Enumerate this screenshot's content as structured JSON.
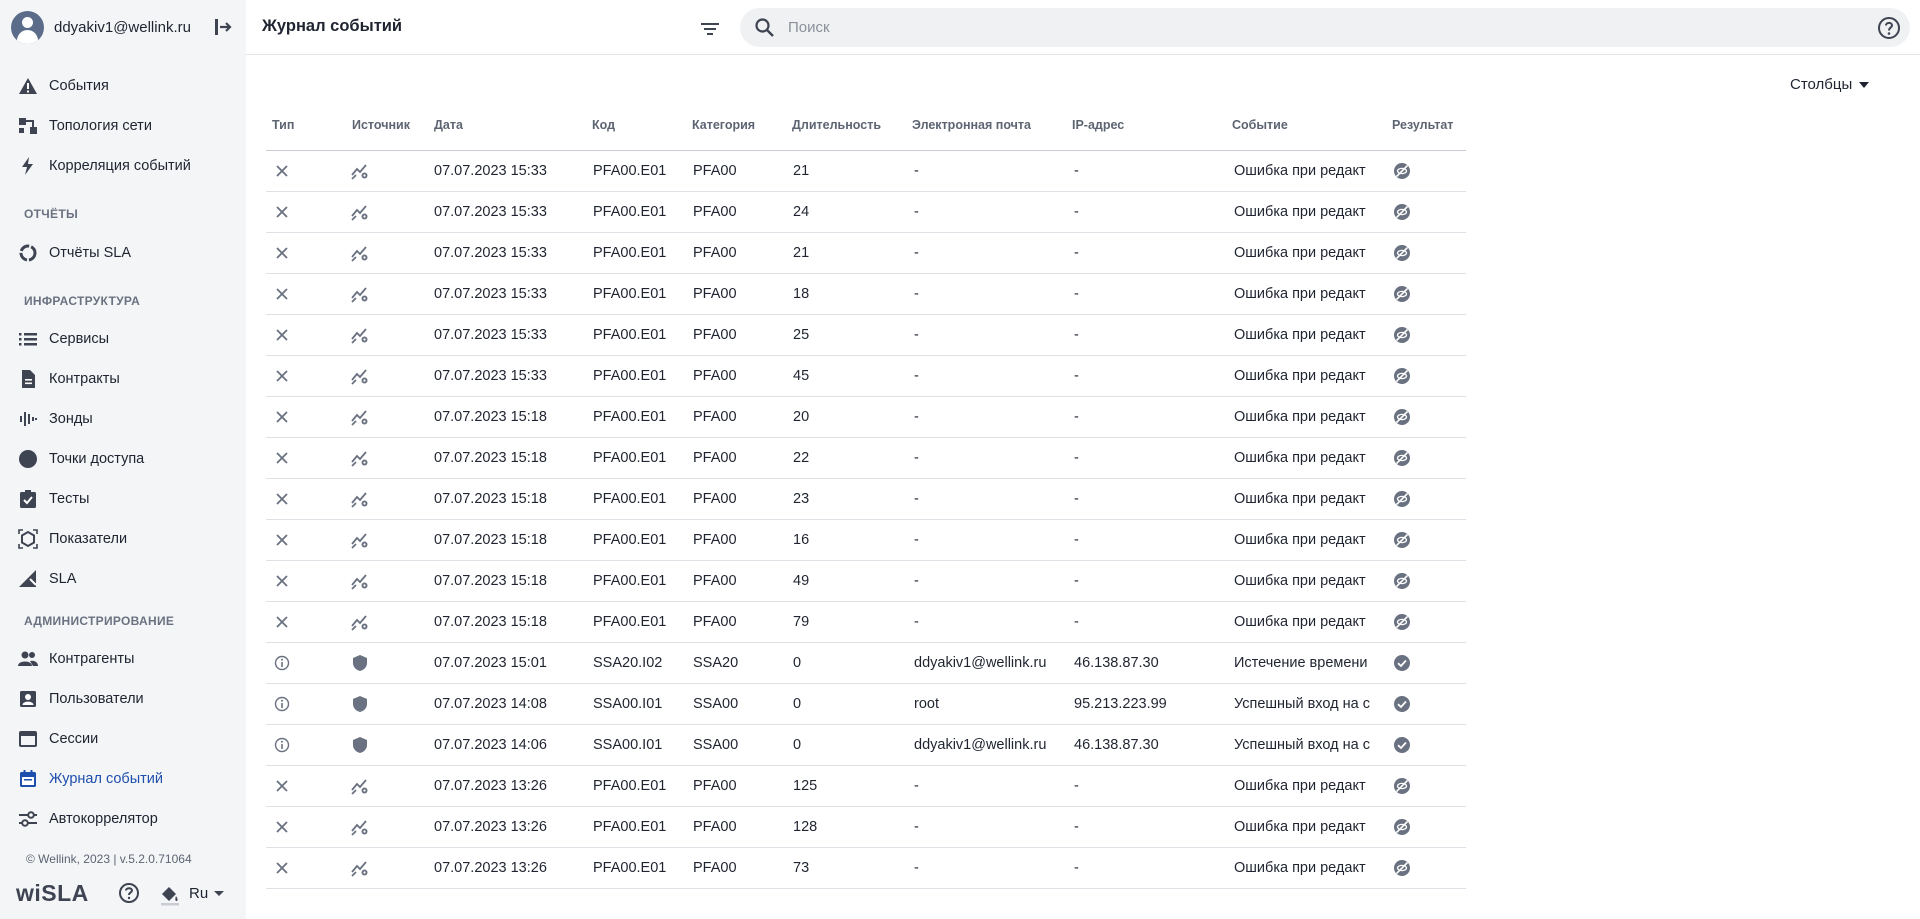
{
  "user": {
    "email": "ddyakiv1@wellink.ru"
  },
  "sidebar": {
    "items_top": [
      {
        "label": "События",
        "icon": "warning-icon"
      },
      {
        "label": "Топология сети",
        "icon": "topology-icon"
      },
      {
        "label": "Корреляция событий",
        "icon": "bolt-icon"
      }
    ],
    "sections": [
      {
        "title": "ОТЧЁТЫ"
      },
      {
        "title": "ИНФРАСТРУКТУРА"
      },
      {
        "title": "АДМИНИСТРИРОВАНИЕ"
      }
    ],
    "reports_items": [
      {
        "label": "Отчёты SLA",
        "icon": "donut-icon"
      }
    ],
    "infra_items": [
      {
        "label": "Сервисы",
        "icon": "list-icon"
      },
      {
        "label": "Контракты",
        "icon": "document-icon"
      },
      {
        "label": "Зонды",
        "icon": "waveform-icon"
      },
      {
        "label": "Точки доступа",
        "icon": "circle-icon"
      },
      {
        "label": "Тесты",
        "icon": "clipboard-check-icon"
      },
      {
        "label": "Показатели",
        "icon": "metrics-icon"
      },
      {
        "label": "SLA",
        "icon": "sla-icon"
      }
    ],
    "admin_items": [
      {
        "label": "Контрагенты",
        "icon": "people-icon"
      },
      {
        "label": "Пользователи",
        "icon": "user-card-icon"
      },
      {
        "label": "Сессии",
        "icon": "window-icon"
      },
      {
        "label": "Журнал событий",
        "icon": "calendar-icon",
        "active": true
      },
      {
        "label": "Автокоррелятор",
        "icon": "sliders-icon"
      }
    ],
    "version": "© Wellink, 2023 | v.5.2.0.71064",
    "logo": "wiSLA",
    "language": "Ru"
  },
  "header": {
    "title": "Журнал событий",
    "search_placeholder": "Поиск"
  },
  "columns_button": "Столбцы",
  "table": {
    "headers": [
      "Тип",
      "Источник",
      "Дата",
      "Код",
      "Категория",
      "Длительность",
      "Электронная почта",
      "IP-адрес",
      "Событие",
      "Результат"
    ],
    "rows": [
      {
        "type": "error",
        "source": "probe",
        "date": "07.07.2023 15:33",
        "code": "PFA00.E01",
        "category": "PFA00",
        "duration": "21",
        "email": "-",
        "ip": "-",
        "event": "Ошибка при редакт",
        "result": "fail"
      },
      {
        "type": "error",
        "source": "probe",
        "date": "07.07.2023 15:33",
        "code": "PFA00.E01",
        "category": "PFA00",
        "duration": "24",
        "email": "-",
        "ip": "-",
        "event": "Ошибка при редакт",
        "result": "fail"
      },
      {
        "type": "error",
        "source": "probe",
        "date": "07.07.2023 15:33",
        "code": "PFA00.E01",
        "category": "PFA00",
        "duration": "21",
        "email": "-",
        "ip": "-",
        "event": "Ошибка при редакт",
        "result": "fail"
      },
      {
        "type": "error",
        "source": "probe",
        "date": "07.07.2023 15:33",
        "code": "PFA00.E01",
        "category": "PFA00",
        "duration": "18",
        "email": "-",
        "ip": "-",
        "event": "Ошибка при редакт",
        "result": "fail"
      },
      {
        "type": "error",
        "source": "probe",
        "date": "07.07.2023 15:33",
        "code": "PFA00.E01",
        "category": "PFA00",
        "duration": "25",
        "email": "-",
        "ip": "-",
        "event": "Ошибка при редакт",
        "result": "fail"
      },
      {
        "type": "error",
        "source": "probe",
        "date": "07.07.2023 15:33",
        "code": "PFA00.E01",
        "category": "PFA00",
        "duration": "45",
        "email": "-",
        "ip": "-",
        "event": "Ошибка при редакт",
        "result": "fail"
      },
      {
        "type": "error",
        "source": "probe",
        "date": "07.07.2023 15:18",
        "code": "PFA00.E01",
        "category": "PFA00",
        "duration": "20",
        "email": "-",
        "ip": "-",
        "event": "Ошибка при редакт",
        "result": "fail"
      },
      {
        "type": "error",
        "source": "probe",
        "date": "07.07.2023 15:18",
        "code": "PFA00.E01",
        "category": "PFA00",
        "duration": "22",
        "email": "-",
        "ip": "-",
        "event": "Ошибка при редакт",
        "result": "fail"
      },
      {
        "type": "error",
        "source": "probe",
        "date": "07.07.2023 15:18",
        "code": "PFA00.E01",
        "category": "PFA00",
        "duration": "23",
        "email": "-",
        "ip": "-",
        "event": "Ошибка при редакт",
        "result": "fail"
      },
      {
        "type": "error",
        "source": "probe",
        "date": "07.07.2023 15:18",
        "code": "PFA00.E01",
        "category": "PFA00",
        "duration": "16",
        "email": "-",
        "ip": "-",
        "event": "Ошибка при редакт",
        "result": "fail"
      },
      {
        "type": "error",
        "source": "probe",
        "date": "07.07.2023 15:18",
        "code": "PFA00.E01",
        "category": "PFA00",
        "duration": "49",
        "email": "-",
        "ip": "-",
        "event": "Ошибка при редакт",
        "result": "fail"
      },
      {
        "type": "error",
        "source": "probe",
        "date": "07.07.2023 15:18",
        "code": "PFA00.E01",
        "category": "PFA00",
        "duration": "79",
        "email": "-",
        "ip": "-",
        "event": "Ошибка при редакт",
        "result": "fail"
      },
      {
        "type": "info",
        "source": "security",
        "date": "07.07.2023 15:01",
        "code": "SSA20.I02",
        "category": "SSA20",
        "duration": "0",
        "email": "ddyakiv1@wellink.ru",
        "ip": "46.138.87.30",
        "event": "Истечение времени",
        "result": "ok"
      },
      {
        "type": "info",
        "source": "security",
        "date": "07.07.2023 14:08",
        "code": "SSA00.I01",
        "category": "SSA00",
        "duration": "0",
        "email": "root",
        "ip": "95.213.223.99",
        "event": "Успешный вход на с",
        "result": "ok"
      },
      {
        "type": "info",
        "source": "security",
        "date": "07.07.2023 14:06",
        "code": "SSA00.I01",
        "category": "SSA00",
        "duration": "0",
        "email": "ddyakiv1@wellink.ru",
        "ip": "46.138.87.30",
        "event": "Успешный вход на с",
        "result": "ok"
      },
      {
        "type": "error",
        "source": "probe",
        "date": "07.07.2023 13:26",
        "code": "PFA00.E01",
        "category": "PFA00",
        "duration": "125",
        "email": "-",
        "ip": "-",
        "event": "Ошибка при редакт",
        "result": "fail"
      },
      {
        "type": "error",
        "source": "probe",
        "date": "07.07.2023 13:26",
        "code": "PFA00.E01",
        "category": "PFA00",
        "duration": "128",
        "email": "-",
        "ip": "-",
        "event": "Ошибка при редакт",
        "result": "fail"
      },
      {
        "type": "error",
        "source": "probe",
        "date": "07.07.2023 13:26",
        "code": "PFA00.E01",
        "category": "PFA00",
        "duration": "73",
        "email": "-",
        "ip": "-",
        "event": "Ошибка при редакт",
        "result": "fail"
      }
    ]
  },
  "colors": {
    "accent": "#1f4fae",
    "sidebar_bg": "#f4f5f7",
    "text": "#1f2430",
    "muted": "#6a7180"
  }
}
